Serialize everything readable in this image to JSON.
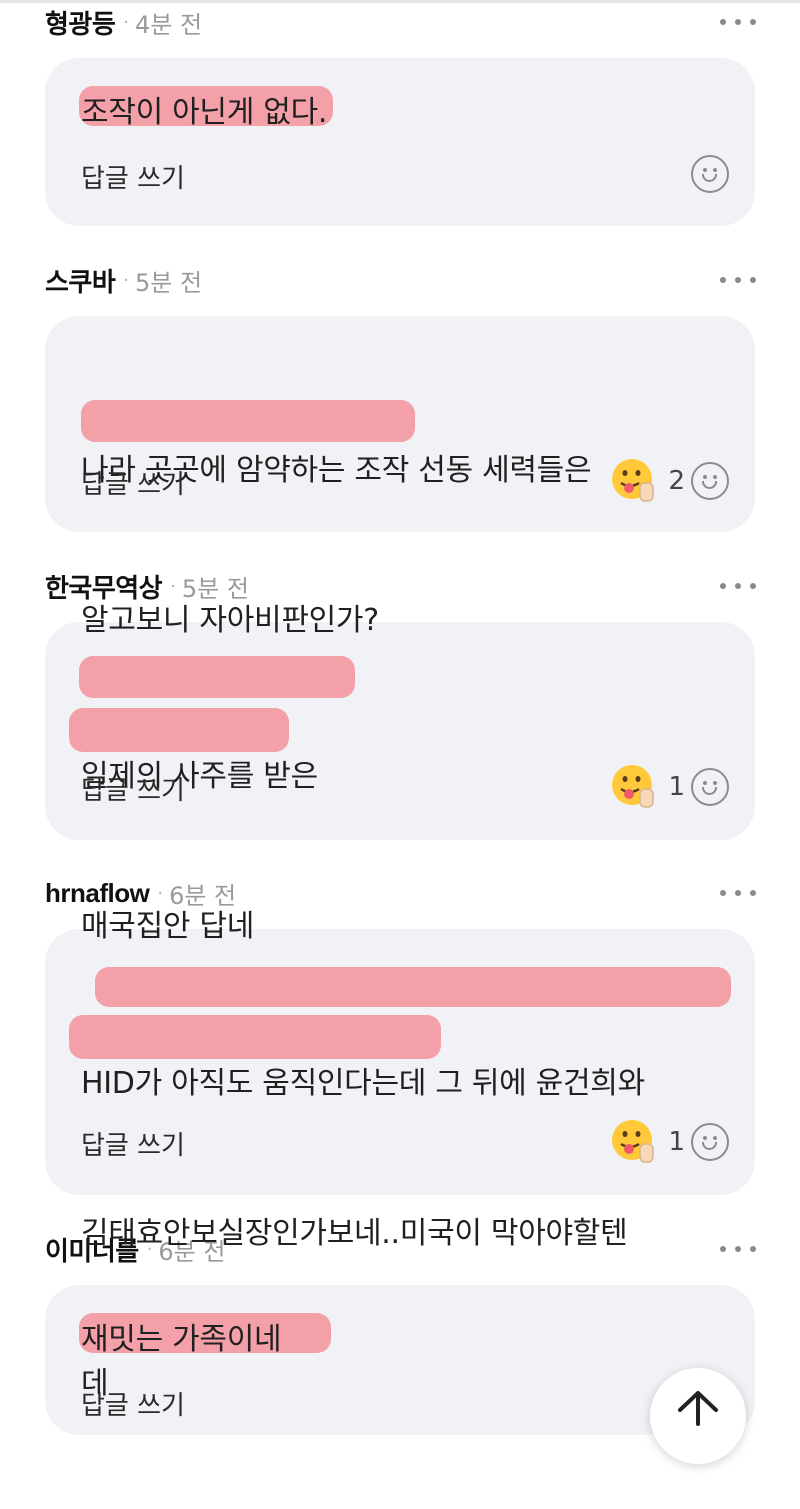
{
  "comments": [
    {
      "author": "형광등",
      "time": "4분 전",
      "lines": [
        "조작이 아닌게 없다."
      ],
      "reply_label": "답글 쓰기",
      "reaction_count": null
    },
    {
      "author": "스쿠바",
      "time": "5분 전",
      "lines": [
        "나라 곳곳에 암약하는 조작 선동 세력들은",
        "알고보니 자아비판인가?"
      ],
      "reply_label": "답글 쓰기",
      "reaction_count": "2"
    },
    {
      "author": "한국무역상",
      "time": "5분 전",
      "lines": [
        "일제의 사주를 받은",
        "매국집안 답네"
      ],
      "reply_label": "답글 쓰기",
      "reaction_count": "1"
    },
    {
      "author": "hrnaflow",
      "time": "6분 전",
      "lines": [
        "HID가 아직도 움직인다는데 그 뒤에 윤건희와",
        "김태효안보실장인가보네..미국이 막아야할텐",
        "데"
      ],
      "reply_label": "답글 쓰기",
      "reaction_count": "1"
    },
    {
      "author": "이미너를",
      "time": "6분 전",
      "lines": [
        "재밋는 가족이네"
      ],
      "reply_label": "답글 쓰기",
      "reaction_count": null
    }
  ],
  "colors": {
    "highlight": "#f45c68",
    "bubble": "#f1f2f6"
  },
  "icons": [
    "more-options-icon",
    "tongue-face-emoji-icon",
    "add-reaction-smiley-icon",
    "arrow-up-icon"
  ]
}
